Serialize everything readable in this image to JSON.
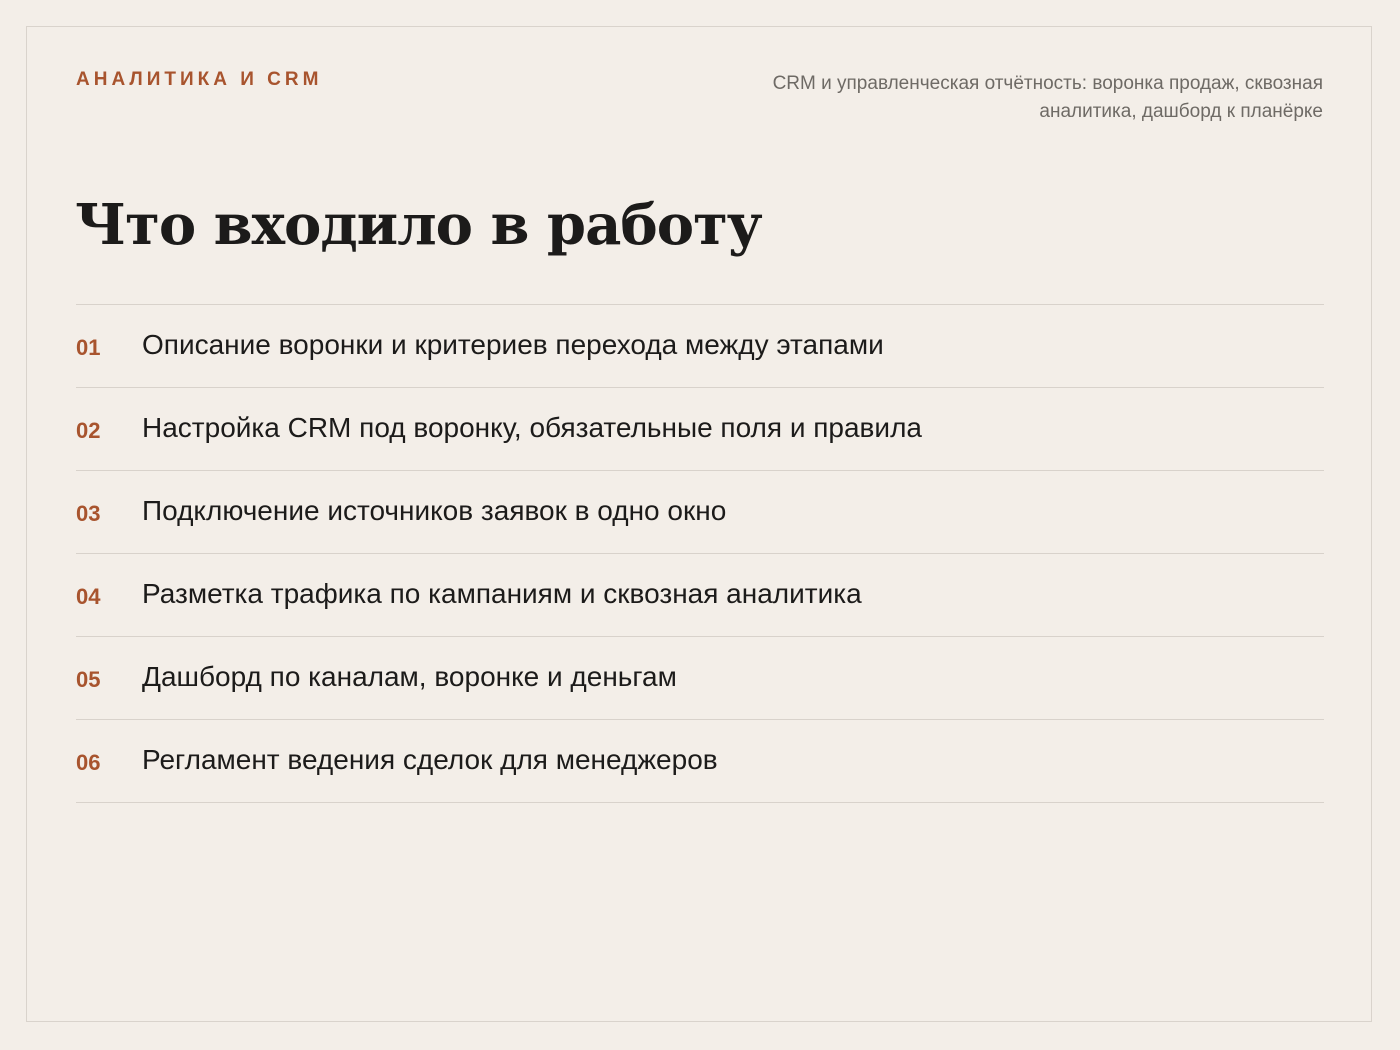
{
  "header": {
    "eyebrow": "АНАЛИТИКА И CRM",
    "subtitle": "CRM и управленческая отчётность: воронка продаж, сквозная аналитика, дашборд к планёрке"
  },
  "title": "Что входило в работу",
  "items": [
    {
      "num": "01",
      "text": "Описание воронки и критериев перехода между этапами"
    },
    {
      "num": "02",
      "text": "Настройка CRM под воронку, обязательные поля и правила"
    },
    {
      "num": "03",
      "text": "Подключение источников заявок в одно окно"
    },
    {
      "num": "04",
      "text": "Разметка трафика по кампаниям и сквозная аналитика"
    },
    {
      "num": "05",
      "text": "Дашборд по каналам, воронке и деньгам"
    },
    {
      "num": "06",
      "text": "Регламент ведения сделок для менеджеров"
    }
  ],
  "colors": {
    "background": "#f3eee8",
    "accent": "#a8542e",
    "text": "#1c1b1a",
    "muted": "#6e6a65",
    "divider": "#d8d2cb"
  }
}
